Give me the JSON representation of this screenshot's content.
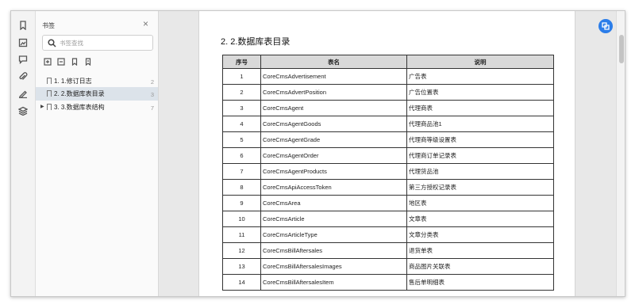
{
  "sidebar": {
    "title": "书签",
    "search_placeholder": "书签查找",
    "bookmarks": [
      {
        "label": "1. 1.修订日志",
        "page": "2",
        "selected": false,
        "expandable": false
      },
      {
        "label": "2. 2.数据库表目录",
        "page": "3",
        "selected": true,
        "expandable": false
      },
      {
        "label": "3. 3.数据库表结构",
        "page": "7",
        "selected": false,
        "expandable": true
      }
    ]
  },
  "document": {
    "heading": "2. 2.数据库表目录",
    "table": {
      "headers": [
        "序号",
        "表名",
        "说明"
      ],
      "rows": [
        [
          "1",
          "CoreCmsAdvertisement",
          "广告表"
        ],
        [
          "2",
          "CoreCmsAdvertPosition",
          "广告位置表"
        ],
        [
          "3",
          "CoreCmsAgent",
          "代理商表"
        ],
        [
          "4",
          "CoreCmsAgentGoods",
          "代理商品池1"
        ],
        [
          "5",
          "CoreCmsAgentGrade",
          "代理商等级设置表"
        ],
        [
          "6",
          "CoreCmsAgentOrder",
          "代理商订单记录表"
        ],
        [
          "7",
          "CoreCmsAgentProducts",
          "代理货品池"
        ],
        [
          "8",
          "CoreCmsApiAccessToken",
          "第三方授权记录表"
        ],
        [
          "9",
          "CoreCmsArea",
          "地区表"
        ],
        [
          "10",
          "CoreCmsArticle",
          "文章表"
        ],
        [
          "11",
          "CoreCmsArticleType",
          "文章分类表"
        ],
        [
          "12",
          "CoreCmsBillAftersales",
          "退货单表"
        ],
        [
          "13",
          "CoreCmsBillAftersalesImages",
          "商品图片关联表"
        ],
        [
          "14",
          "CoreCmsBillAftersalesItem",
          "售后单明细表"
        ]
      ]
    }
  },
  "colors": {
    "accent": "#2b7de9",
    "selected_row": "#dce3ea",
    "table_header": "#d9d9d9"
  }
}
